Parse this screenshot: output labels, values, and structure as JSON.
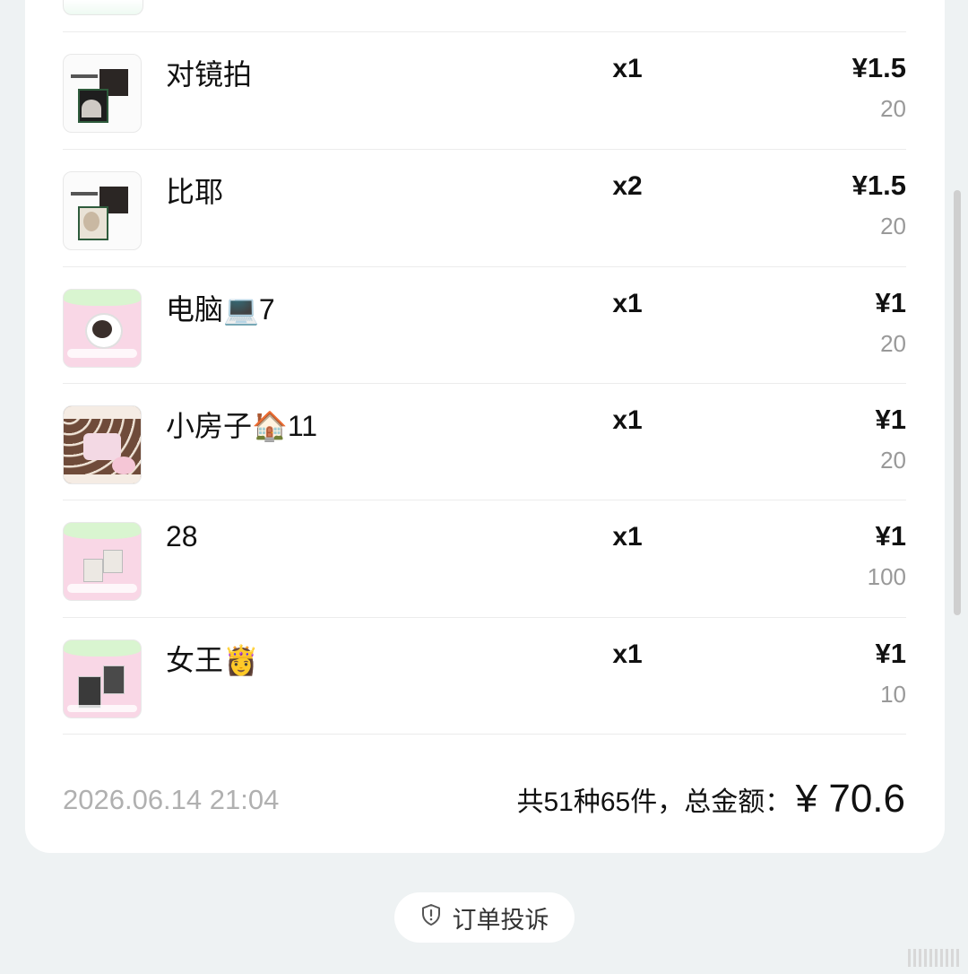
{
  "items": [
    {
      "name": "对镜拍",
      "qty": "x1",
      "price": "¥1.5",
      "stock": "20",
      "thumb": "dark-card-photo"
    },
    {
      "name": "比耶",
      "qty": "x2",
      "price": "¥1.5",
      "stock": "20",
      "thumb": "dark-card-photo"
    },
    {
      "name": "电脑💻7",
      "qty": "x1",
      "price": "¥1",
      "stock": "20",
      "thumb": "pink-green-computer"
    },
    {
      "name": "小房子🏠11",
      "qty": "x1",
      "price": "¥1",
      "stock": "20",
      "thumb": "brown-polka-house"
    },
    {
      "name": "28",
      "qty": "x1",
      "price": "¥1",
      "stock": "100",
      "thumb": "pink-green-photos"
    },
    {
      "name": "女王👸",
      "qty": "x1",
      "price": "¥1",
      "stock": "10",
      "thumb": "pink-green-queen"
    }
  ],
  "footer": {
    "datetime": "2026.06.14 21:04",
    "summary_label": "共51种65件，总金额：",
    "total": "¥ 70.6"
  },
  "complaint_button": {
    "label": "订单投诉",
    "icon": "shield-icon"
  },
  "colors": {
    "page_bg": "#eef2f3",
    "card_bg": "#ffffff",
    "muted_text": "#999999",
    "thumb_pink": "#f9d7e6",
    "thumb_green": "#d9f5d0",
    "thumb_brown": "#6f4b3a"
  }
}
